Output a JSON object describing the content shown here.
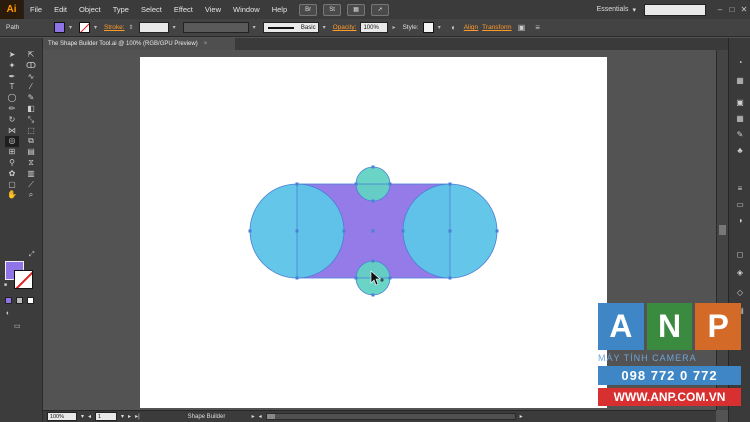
{
  "app": {
    "logo": "Ai"
  },
  "menu": {
    "items": [
      "File",
      "Edit",
      "Object",
      "Type",
      "Select",
      "Effect",
      "View",
      "Window",
      "Help"
    ],
    "br_label": "Br",
    "st_label": "St",
    "workspace": "Essentials"
  },
  "control": {
    "selection_label": "Path",
    "stroke_label": "Stroke:",
    "brush_label": "Basic",
    "opacity_label": "Opacity:",
    "opacity_value": "100%",
    "style_label": "Style:",
    "align_label": "Align",
    "transform_label": "Transform"
  },
  "document": {
    "tab_title": "The Shape Builder Tool.ai @ 100% (RGB/GPU Preview)",
    "tab_close": "×"
  },
  "status": {
    "zoom": "100%",
    "artboard_number": "1",
    "tool_name": "Shape Builder"
  },
  "colors": {
    "fill": "#8e74e6",
    "blue_shape": "#5fc4e8",
    "teal_shape": "#62d2c4",
    "purple_shape": "#8e74e6",
    "selection": "#4a7fd6"
  },
  "watermark": {
    "letters": [
      "A",
      "N",
      "P"
    ],
    "tagline": "MÁY TÍNH CAMERA",
    "phone": "098 772 0 772",
    "website": "WWW.ANP.COM.VN"
  }
}
